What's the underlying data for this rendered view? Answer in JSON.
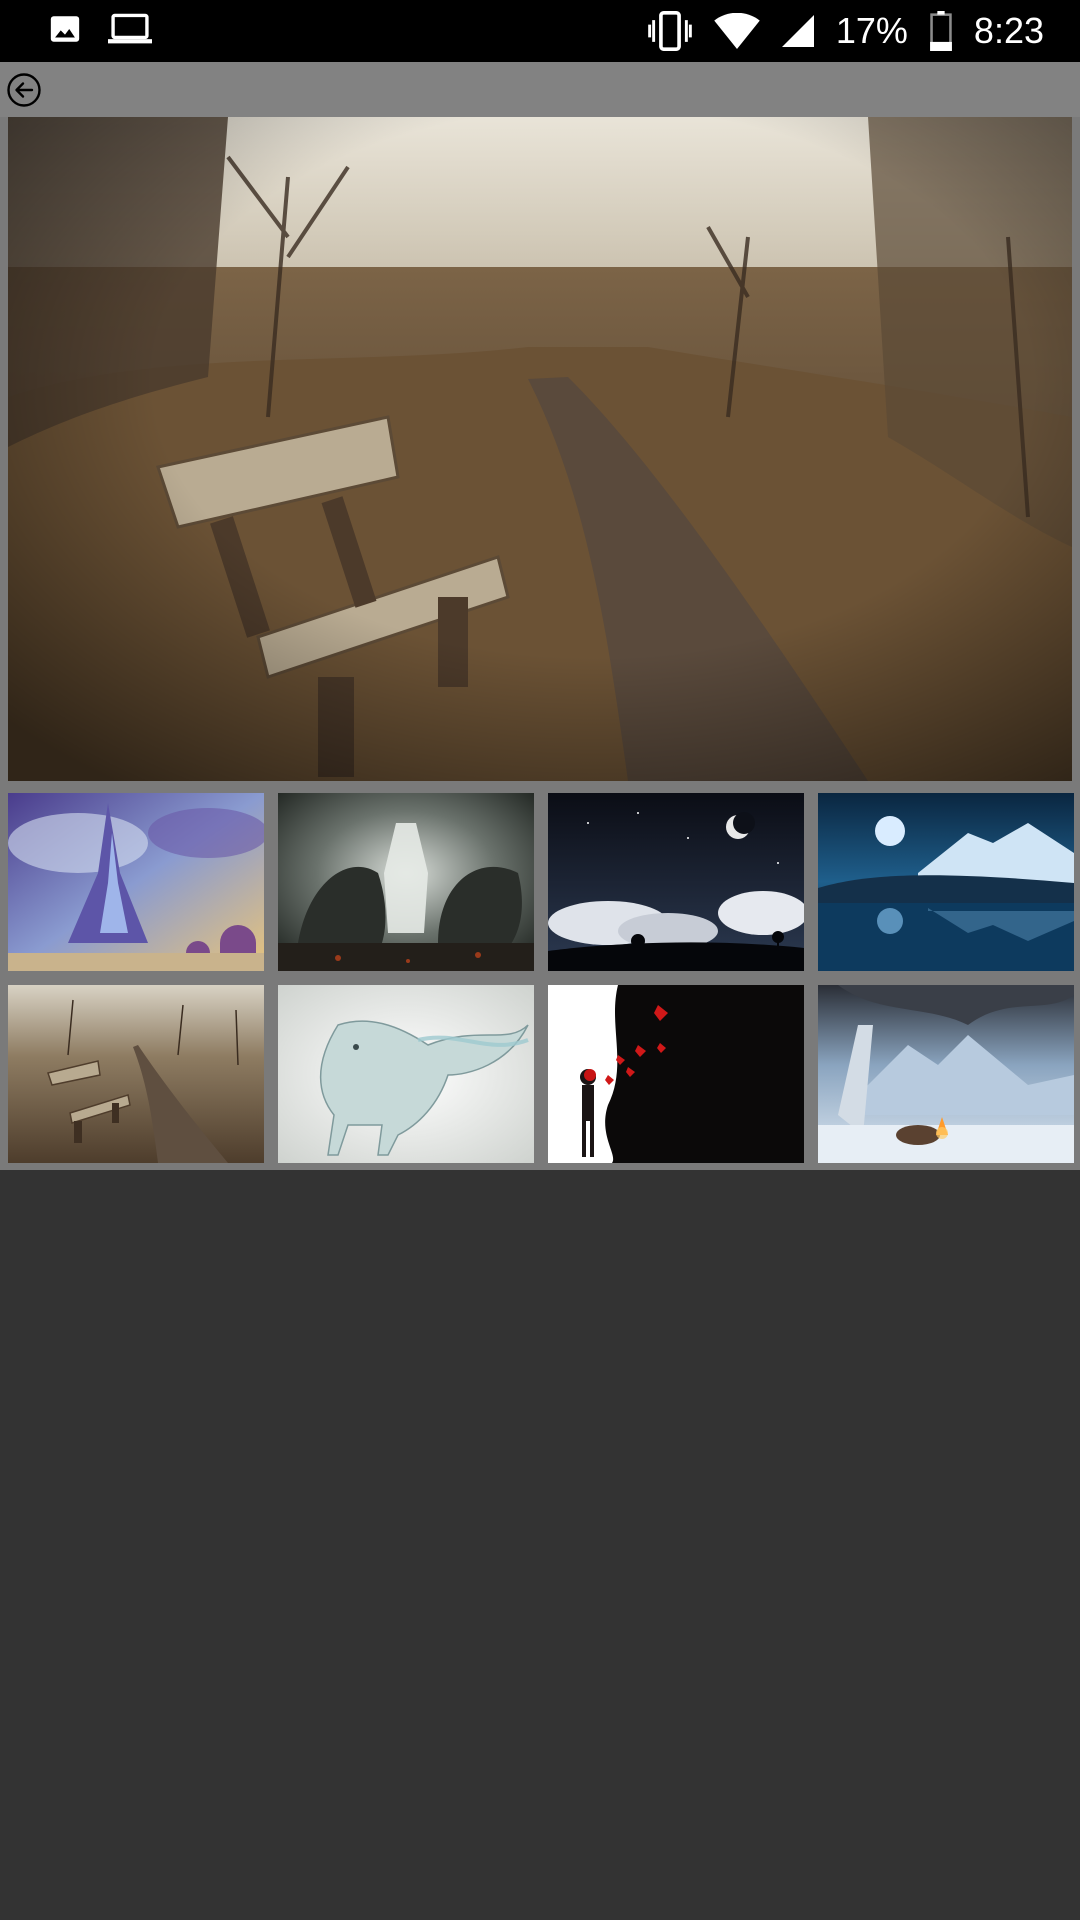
{
  "status_bar": {
    "notifications": [
      "image-icon",
      "laptop-icon"
    ],
    "battery_percent": "17%",
    "time": "8:23",
    "system_icons": [
      "vibrate-icon",
      "wifi-icon",
      "signal-icon",
      "battery-icon"
    ]
  },
  "toolbar": {
    "back_icon": "arrow-back-circle-icon"
  },
  "gallery": {
    "selected_index": 4,
    "thumbnails": [
      "fantasy-castle",
      "dark-creatures",
      "night-moon-clouds",
      "moon-lake-mountains",
      "bench-path",
      "spirit-wolf",
      "silhouette-butterflies",
      "winter-campfire"
    ]
  },
  "colors": {
    "status_bar": "#000000",
    "toolbar": "#828282",
    "panel": "#7a7a7a",
    "background": "#333333"
  }
}
